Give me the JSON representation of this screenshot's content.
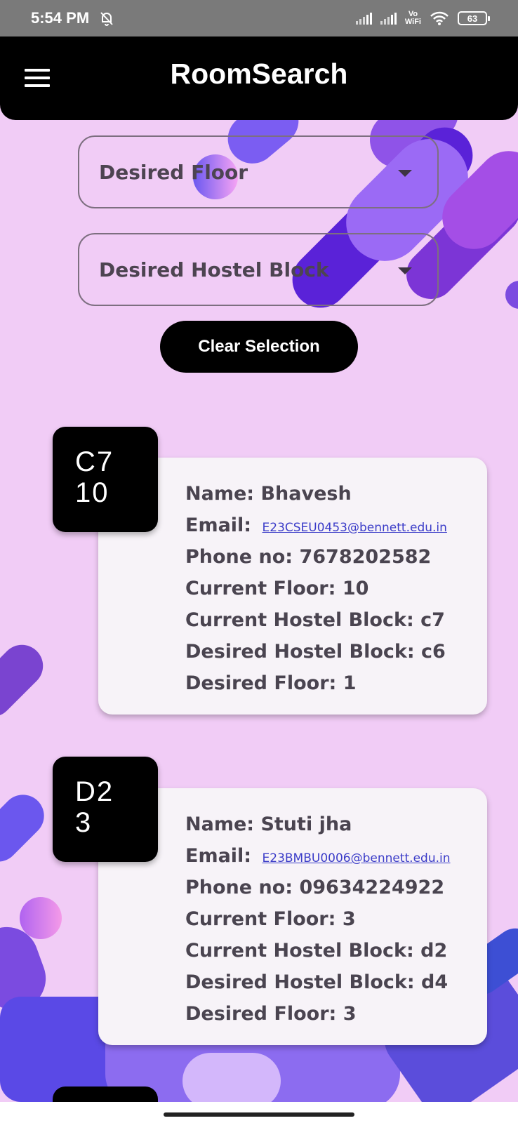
{
  "status_bar": {
    "time": "5:54 PM",
    "icons": [
      "bell-off-icon",
      "signal-icon",
      "signal-icon",
      "vowifi-icon",
      "wifi-icon",
      "battery-icon"
    ],
    "vowifi_top": "Vo",
    "vowifi_bottom": "WiFi",
    "battery": "63"
  },
  "app_bar": {
    "title": "RoomSearch",
    "menu_icon": "hamburger-menu-icon"
  },
  "filters": {
    "floor_placeholder": "Desired Floor",
    "block_placeholder": "Desired Hostel Block",
    "clear_label": "Clear Selection"
  },
  "rooms": [
    {
      "badge_block": "C7",
      "badge_floor": "10",
      "name_label": "Name: Bhavesh",
      "email_label": "Email:",
      "email": "E23CSEU0453@bennett.edu.in",
      "phone": "Phone no: 7678202582",
      "current_floor": "Current Floor: 10",
      "current_block": "Current Hostel Block: c7",
      "desired_block": "Desired Hostel Block: c6",
      "desired_floor": "Desired Floor: 1"
    },
    {
      "badge_block": "D2",
      "badge_floor": "3",
      "name_label": "Name: Stuti jha",
      "email_label": "Email:",
      "email": "E23BMBU0006@bennett.edu.in",
      "phone": "Phone no: 09634224922",
      "current_floor": "Current Floor: 3",
      "current_block": "Current Hostel Block: d2",
      "desired_block": "Desired Hostel Block: d4",
      "desired_floor": "Desired Floor: 3"
    }
  ],
  "colors": {
    "background": "#f1ccf6",
    "app_bar": "#000000",
    "card": "#f7f3f8",
    "link": "#3b3cc8"
  }
}
